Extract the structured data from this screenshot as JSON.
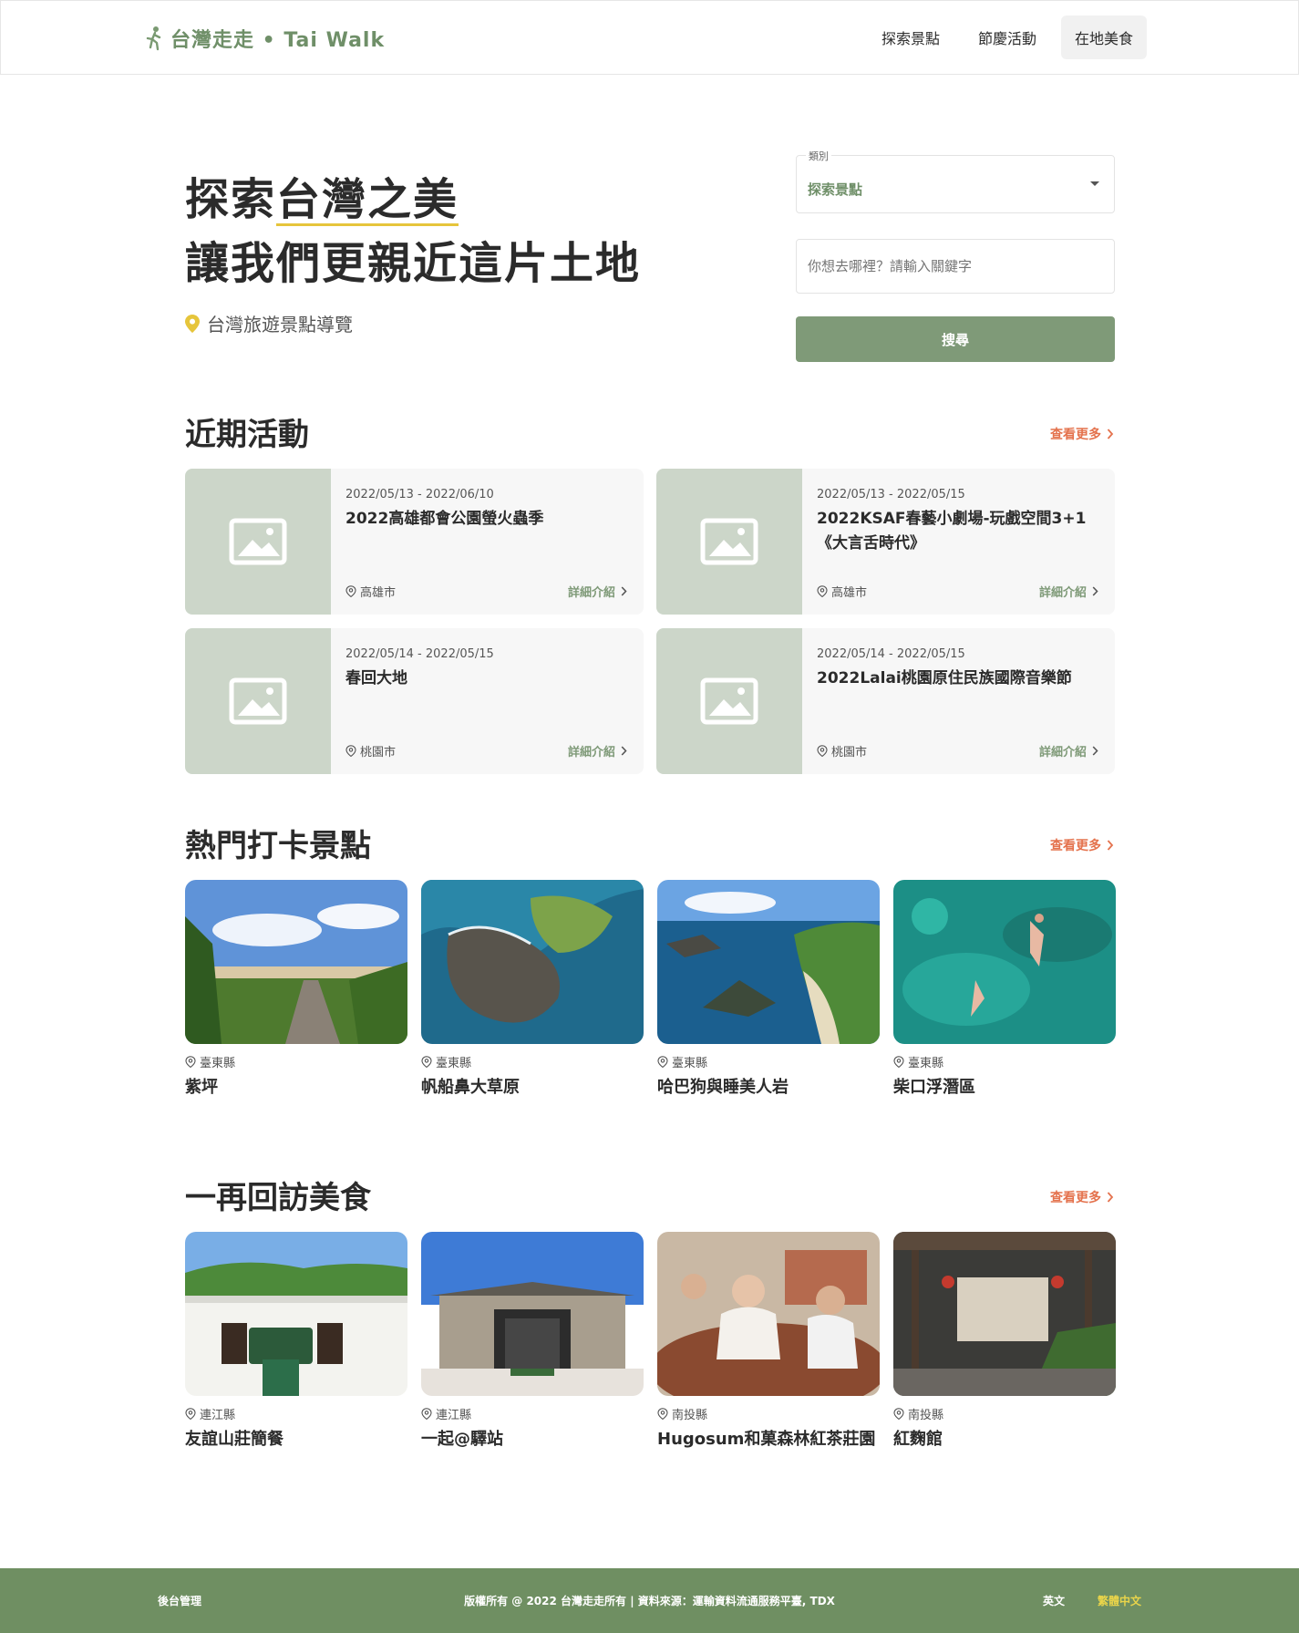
{
  "header": {
    "logo_text": "台灣走走 • Tai Walk",
    "nav": [
      {
        "label": "探索景點"
      },
      {
        "label": "節慶活動"
      },
      {
        "label": "在地美食"
      }
    ]
  },
  "hero": {
    "title_highlight": "台灣之美",
    "title_prefix": "探索",
    "title_line2": "讓我們更親近這片土地",
    "subtitle": "台灣旅遊景點導覽"
  },
  "search": {
    "category_label": "類別",
    "category_value": "探索景點",
    "keyword_placeholder": "你想去哪裡？請輸入關鍵字",
    "button_label": "搜尋"
  },
  "events_section": {
    "title": "近期活動",
    "more_label": "查看更多",
    "detail_label": "詳細介紹",
    "items": [
      {
        "date": "2022/05/13 - 2022/06/10",
        "name": "2022高雄都會公園螢火蟲季",
        "city": "高雄市"
      },
      {
        "date": "2022/05/13 - 2022/05/15",
        "name": "2022KSAF春藝小劇場-玩戲空間3+1《大言舌時代》",
        "city": "高雄市"
      },
      {
        "date": "2022/05/14 - 2022/05/15",
        "name": "春回大地",
        "city": "桃園市"
      },
      {
        "date": "2022/05/14 - 2022/05/15",
        "name": "2022Lalai桃園原住民族國際音樂節",
        "city": "桃園市"
      }
    ]
  },
  "spots_section": {
    "title": "熱門打卡景點",
    "more_label": "查看更多",
    "items": [
      {
        "county": "臺東縣",
        "name": "紫坪"
      },
      {
        "county": "臺東縣",
        "name": "帆船鼻大草原"
      },
      {
        "county": "臺東縣",
        "name": "哈巴狗與睡美人岩"
      },
      {
        "county": "臺東縣",
        "name": "柴口浮潛區"
      }
    ]
  },
  "food_section": {
    "title": "一再回訪美食",
    "more_label": "查看更多",
    "items": [
      {
        "county": "連江縣",
        "name": "友誼山莊簡餐"
      },
      {
        "county": "連江縣",
        "name": "一起@驛站"
      },
      {
        "county": "南投縣",
        "name": "Hugosum和菓森林紅茶莊園"
      },
      {
        "county": "南投縣",
        "name": "紅麴館"
      }
    ]
  },
  "footer": {
    "admin": "後台管理",
    "copyright": "版權所有 @ 2022 台灣走走所有 | 資料來源：運輸資料流通服務平臺, TDX",
    "lang_en": "英文",
    "lang_zh": "繁體中文"
  },
  "colors": {
    "brand_green": "#7f9a78",
    "accent_orange": "#e4724d",
    "highlight_yellow": "#e6c53b",
    "footer_green": "#6f8f62"
  }
}
